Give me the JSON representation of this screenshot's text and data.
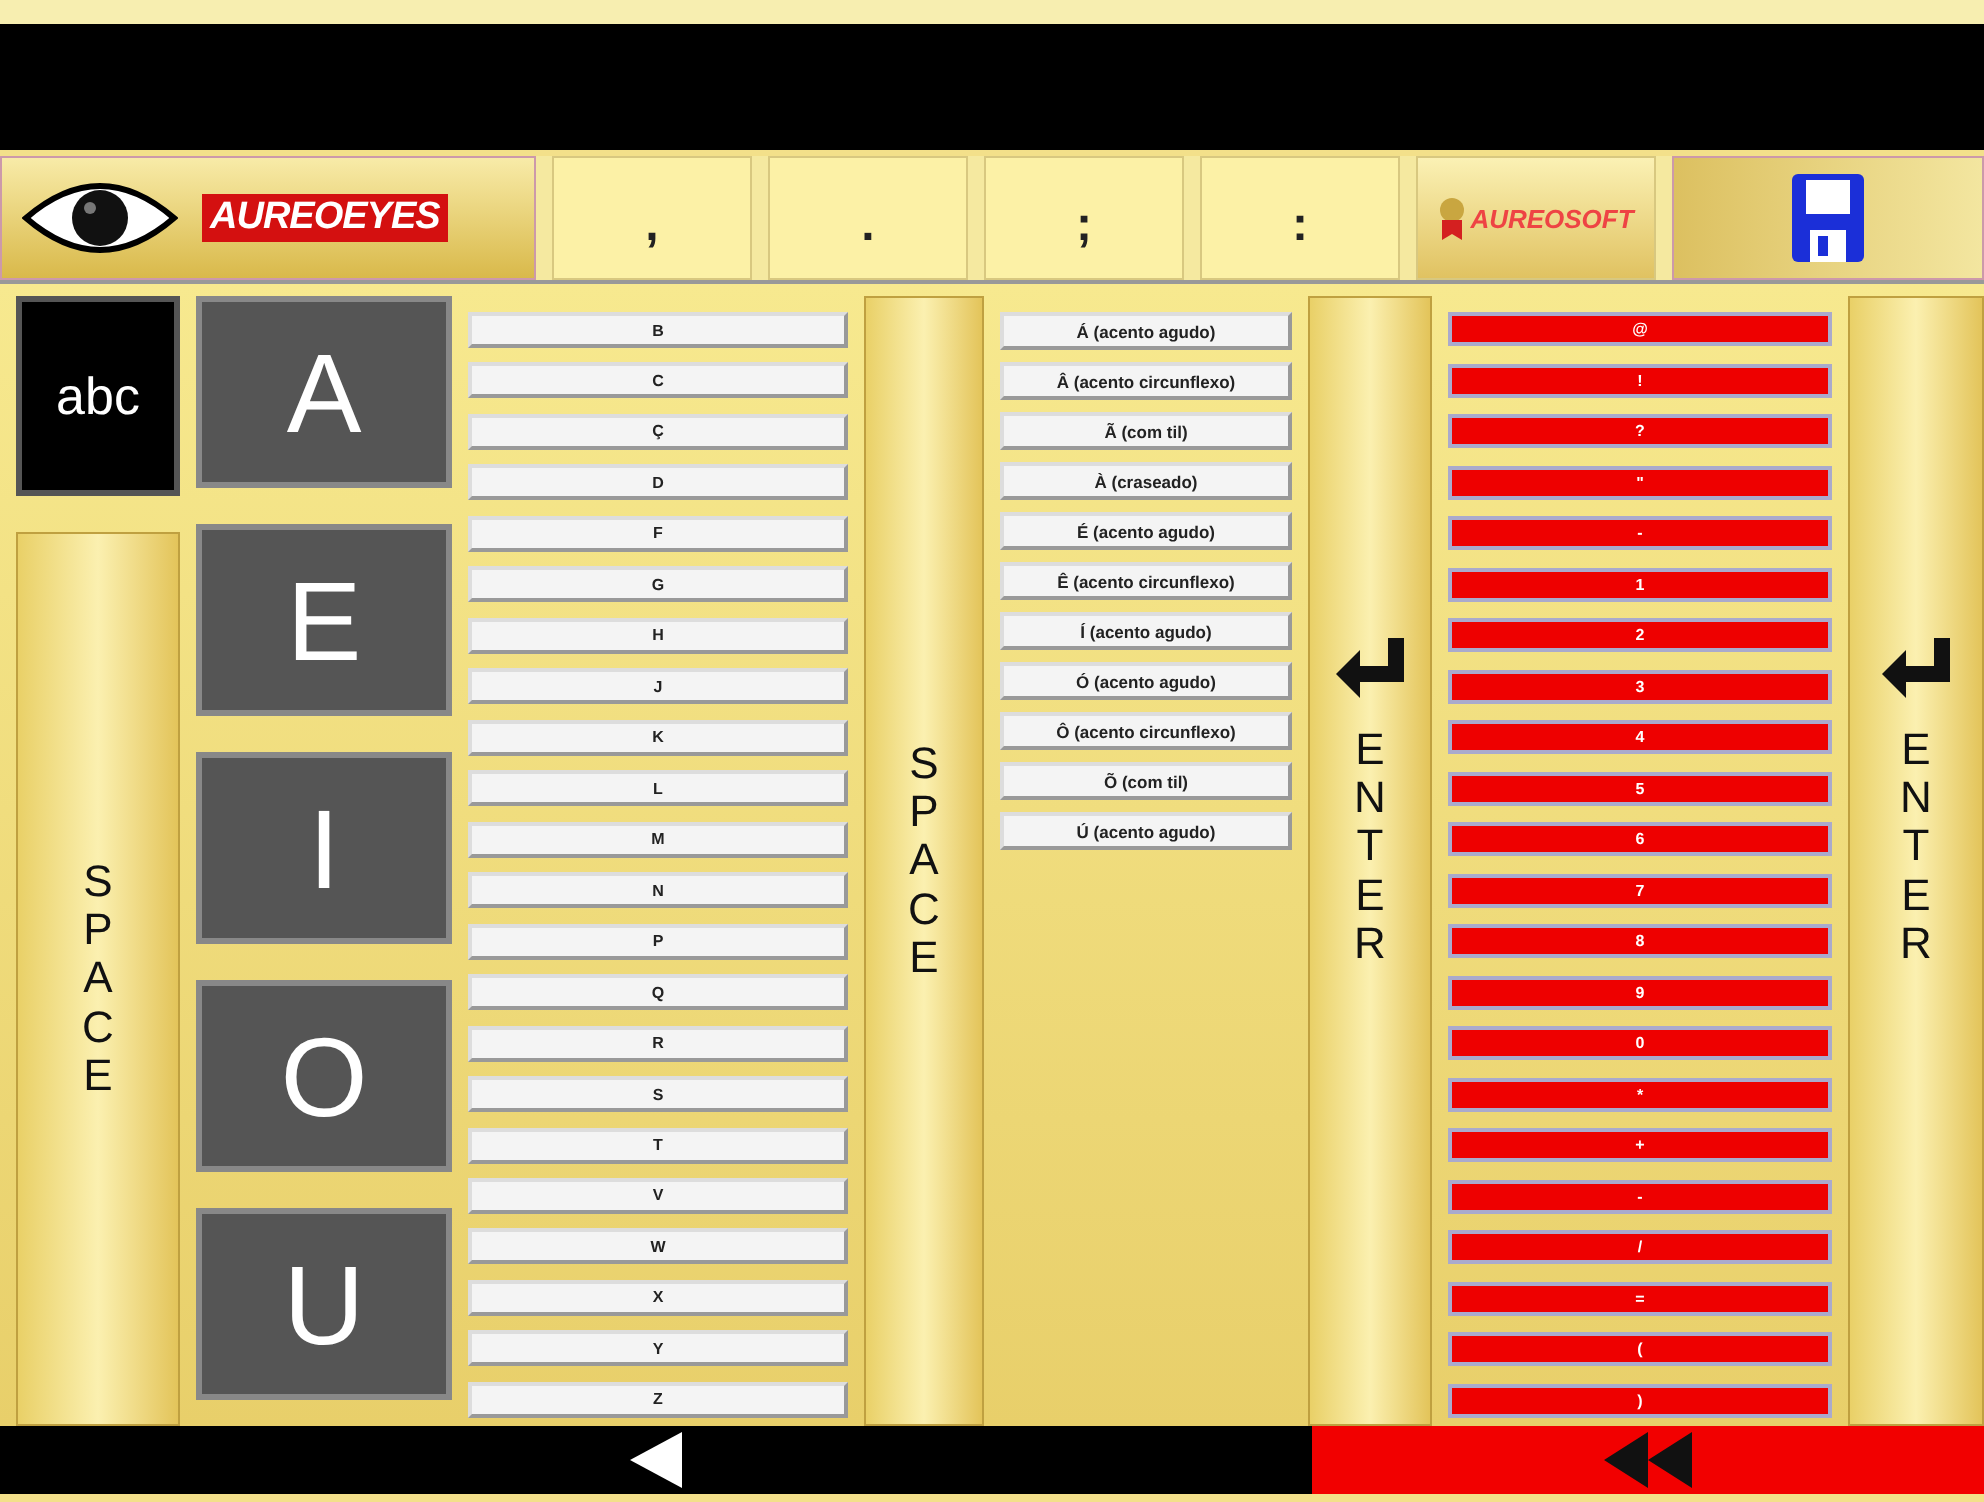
{
  "header": {
    "logo": "AUREOEYES",
    "punctuation_keys": [
      ",",
      ".",
      ";",
      ":"
    ],
    "brand": "AUREOSOFT"
  },
  "left_column": {
    "mode_key": "abc",
    "space_key": "SPACE"
  },
  "vowel_keys": [
    "A",
    "E",
    "I",
    "O",
    "U"
  ],
  "consonant_keys": [
    "B",
    "C",
    "Ç",
    "D",
    "F",
    "G",
    "H",
    "J",
    "K",
    "L",
    "M",
    "N",
    "P",
    "Q",
    "R",
    "S",
    "T",
    "V",
    "W",
    "X",
    "Y",
    "Z"
  ],
  "center_space_key": "SPACE",
  "accent_keys": [
    "Á (acento agudo)",
    "Â (acento circunflexo)",
    "Ã (com til)",
    "À (craseado)",
    "É (acento agudo)",
    "Ê (acento circunflexo)",
    "Í (acento agudo)",
    "Ó (acento agudo)",
    "Ô (acento circunflexo)",
    "Õ (com til)",
    "Ú (acento agudo)"
  ],
  "enter_key_left": "ENTER",
  "symbol_keys": [
    "@",
    "!",
    "?",
    "\"",
    "-",
    "1",
    "2",
    "3",
    "4",
    "5",
    "6",
    "7",
    "8",
    "9",
    "0",
    "*",
    "+",
    "-",
    "/",
    "=",
    "(",
    ")"
  ],
  "enter_key_right": "ENTER"
}
